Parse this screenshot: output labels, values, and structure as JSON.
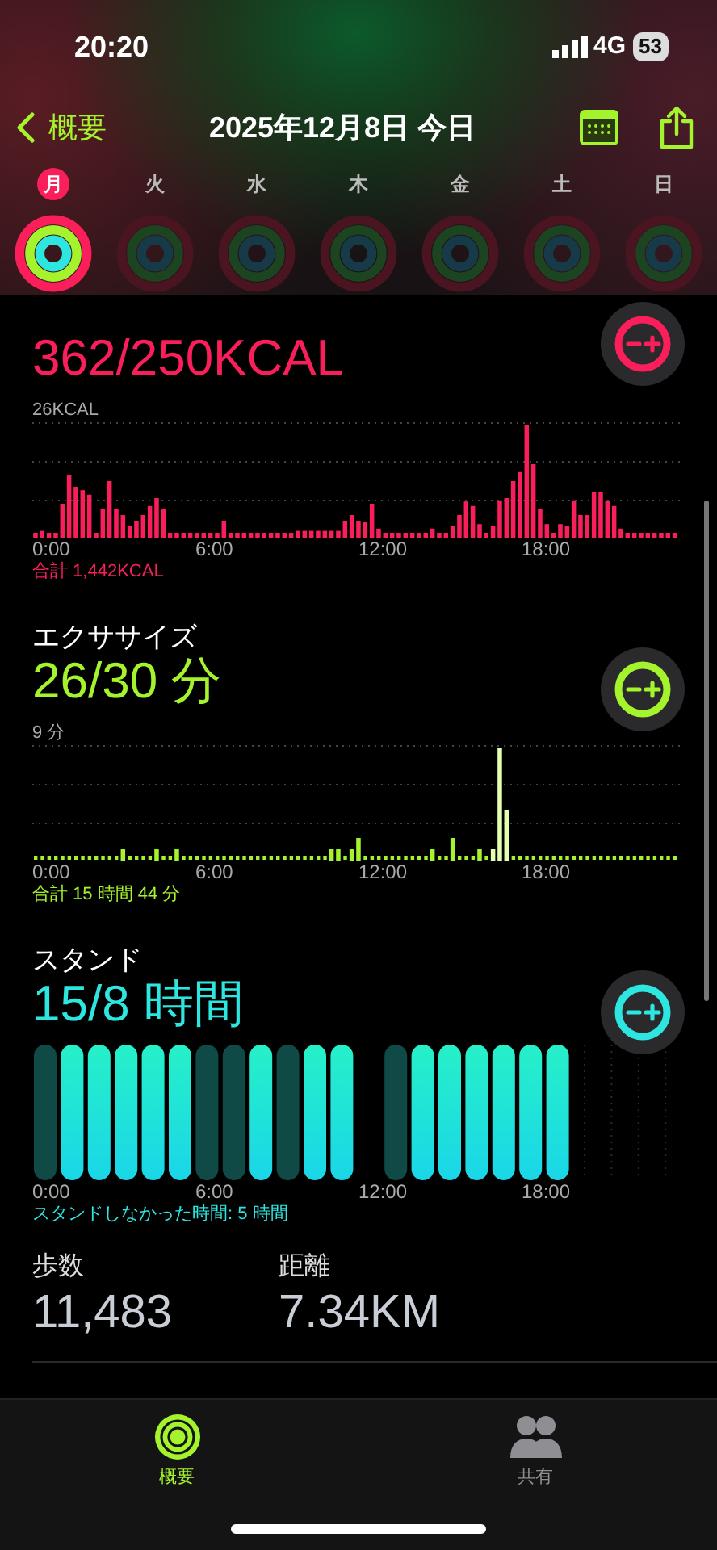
{
  "status_bar": {
    "time": "20:20",
    "network": "4G",
    "battery": "53"
  },
  "nav": {
    "back": "概要",
    "title": "2025年12月8日 今日"
  },
  "week": [
    {
      "day": "月",
      "selected": true
    },
    {
      "day": "火",
      "selected": false
    },
    {
      "day": "水",
      "selected": false
    },
    {
      "day": "木",
      "selected": false
    },
    {
      "day": "金",
      "selected": false
    },
    {
      "day": "土",
      "selected": false
    },
    {
      "day": "日",
      "selected": false
    }
  ],
  "sections": [
    {
      "kind": "move",
      "color": "#fa1f5b",
      "value": "362/250KCAL",
      "max_label": "26KCAL",
      "x_labels": [
        "0:00",
        "6:00",
        "12:00",
        "18:00"
      ],
      "total": "合計 1,442KCAL"
    },
    {
      "kind": "exercise",
      "color": "#a4f32c",
      "title": "エクササイズ",
      "value": "26/30 分",
      "max_label": "9 分",
      "x_labels": [
        "0:00",
        "6:00",
        "12:00",
        "18:00"
      ],
      "total": "合計 15 時間 44 分"
    },
    {
      "kind": "stand",
      "color": "#2ee6e0",
      "title": "スタンド",
      "value": "15/8 時間",
      "x_labels": [
        "0:00",
        "6:00",
        "12:00",
        "18:00"
      ],
      "total": "スタンドしなかった時間: 5 時間"
    }
  ],
  "stats": [
    {
      "label": "歩数",
      "value": "11,483"
    },
    {
      "label": "距離",
      "value": "7.34KM"
    }
  ],
  "tab_bar": [
    {
      "label": "概要",
      "selected": true
    },
    {
      "label": "共有",
      "selected": false
    }
  ]
}
